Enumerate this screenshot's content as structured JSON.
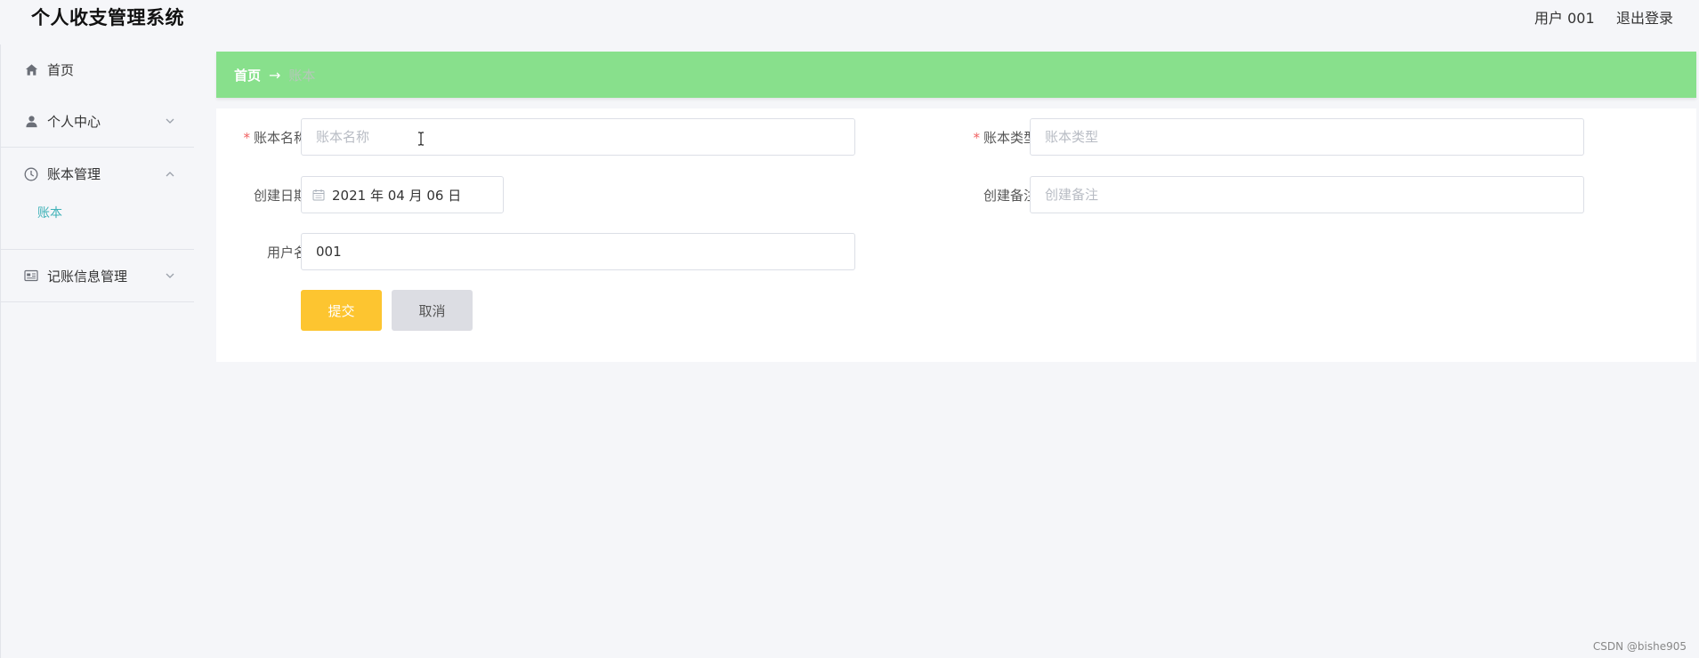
{
  "header": {
    "app_title": "个人收支管理系统",
    "user_label": "用户 001",
    "logout_label": "退出登录"
  },
  "sidebar": {
    "items": [
      {
        "label": "首页",
        "icon": "home-icon"
      },
      {
        "label": "个人中心",
        "icon": "user-icon",
        "expanded": false
      },
      {
        "label": "账本管理",
        "icon": "clock-icon",
        "expanded": true,
        "children": [
          {
            "label": "账本",
            "active": true
          }
        ]
      },
      {
        "label": "记账信息管理",
        "icon": "card-icon",
        "expanded": false
      }
    ]
  },
  "breadcrumb": {
    "home": "首页",
    "separator": "→",
    "current": "账本"
  },
  "form": {
    "account_name": {
      "label": "账本名称",
      "required": true,
      "value": "",
      "placeholder": "账本名称"
    },
    "account_type": {
      "label": "账本类型",
      "required": true,
      "value": "",
      "placeholder": "账本类型"
    },
    "create_date": {
      "label": "创建日期",
      "value": "2021 年 04 月 06 日"
    },
    "create_note": {
      "label": "创建备注",
      "value": "",
      "placeholder": "创建备注"
    },
    "username": {
      "label": "用户名",
      "value": "001"
    },
    "submit_label": "提交",
    "cancel_label": "取消"
  },
  "watermark": "CSDN @bishe905",
  "colors": {
    "breadcrumb_bg": "#88e08c",
    "submit_bg": "#fdc530",
    "cancel_bg": "#dcdde3",
    "active_submenu": "#3fb2b8",
    "required_mark": "#f06060"
  }
}
